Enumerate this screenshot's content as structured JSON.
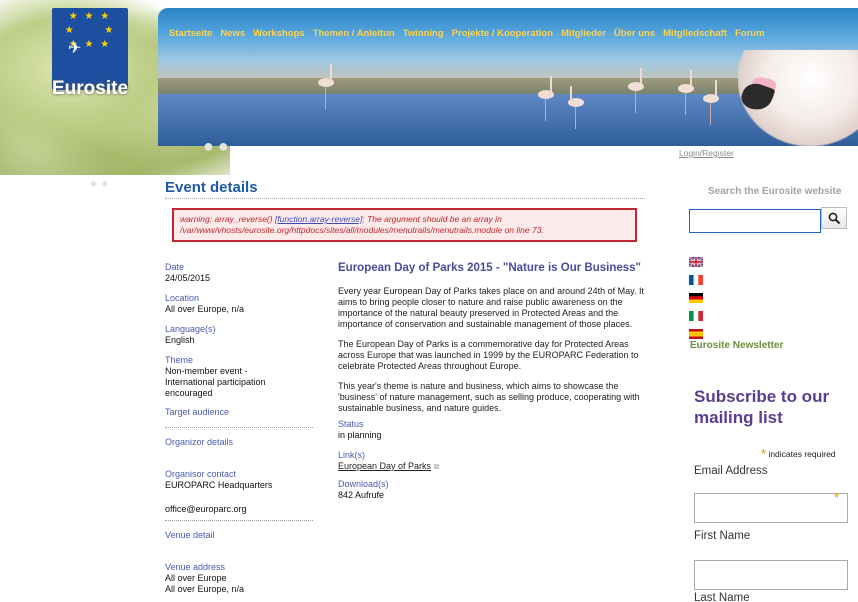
{
  "brand": {
    "logo_text": "Eurosite"
  },
  "nav": [
    "Startseite",
    "News",
    "Workshops",
    "Themen / Anleitun",
    "Twinning",
    "Projekte / Kooperation",
    "Mitglieder",
    "Über uns",
    "Mitgliedschaft",
    "Forum"
  ],
  "login_link": "Login/Register",
  "page_title": "Event details",
  "warning": {
    "prefix": "warning: array_reverse() ",
    "function_link": "[function.array-reverse]",
    "message": ": The argument should be an array in /var/www/vhosts/eurosite.org/httpdocs/sites/all/modules/menutrails/menutrails.module on line 73."
  },
  "details": {
    "date_label": "Date",
    "date": "24/05/2015",
    "location_label": "Location",
    "location": "All over Europe, n/a",
    "language_label": "Language(s)",
    "language": "English",
    "theme_label": "Theme",
    "theme": "Non-member event - International participation encouraged",
    "target_label": "Target audience",
    "organizor_label": "Organizor details",
    "contact_label": "Organisor contact",
    "contact_name": "EUROPARC Headquarters",
    "contact_email": "office@europarc.org",
    "venue_label": "Venue detail",
    "venue_address_label": "Venue address",
    "venue_address_1": "All over Europe",
    "venue_address_2": "All over Europe, n/a"
  },
  "event": {
    "title": "European Day of Parks 2015 - \"Nature is Our Business\"",
    "p1": "Every year European Day of Parks takes place on and around 24th of May. It aims to bring people closer to nature and raise public awareness on the importance of the natural beauty preserved in Protected Areas and the importance of conservation and sustainable management of those places.",
    "p2": "The European Day of Parks is a commemorative day for Protected Areas across Europe that was launched in 1999 by the EUROPARC Federation to celebrate Protected Areas throughout Europe.",
    "p3": "This year's theme is nature and business, which aims to showcase the 'business' of nature management, such as selling produce, cooperating with sustainable business, and nature guides.",
    "status_label": "Status",
    "status": "in planning",
    "links_label": "Link(s)",
    "link_text": "European Day of Parks",
    "downloads_label": "Download(s)",
    "downloads": "842 Aufrufe"
  },
  "sidebar": {
    "search_label": "Search the Eurosite website",
    "search_placeholder": "",
    "search_icon": "magnifier-icon",
    "flags": [
      "uk-flag-icon",
      "france-flag-icon",
      "germany-flag-icon",
      "italy-flag-icon",
      "spain-flag-icon"
    ],
    "newsletter": "Eurosite Newsletter",
    "subscribe": "Subscribe to our mailing list",
    "required_note": "indicates required",
    "email_label": "Email Address",
    "first_name_label": "First Name",
    "last_name_label": "Last Name"
  },
  "colors": {
    "nav_text": "#ffd24a",
    "title_blue": "#1e5aa8",
    "warning_red": "#c0262c",
    "subscribe_purple": "#5b3d8f",
    "newsletter_green": "#6b8f3c"
  }
}
